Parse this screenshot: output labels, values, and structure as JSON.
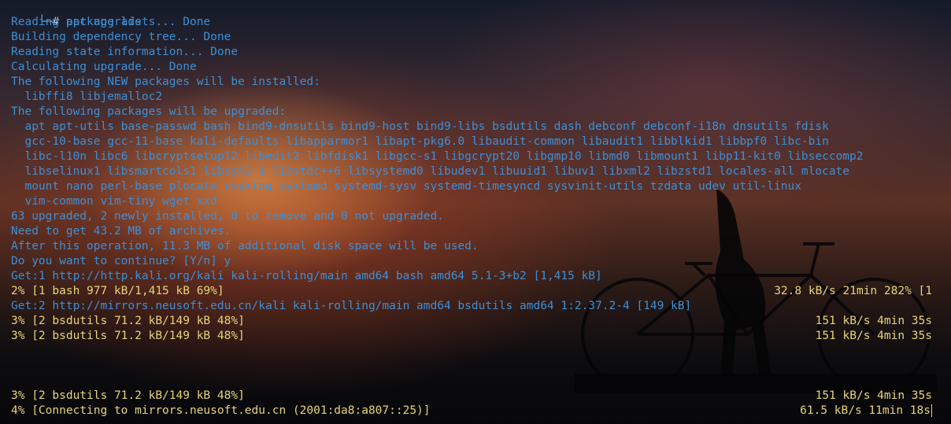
{
  "terminal": {
    "prompt": {
      "corner": "└─",
      "hash": "#",
      "command": "apt upgrade"
    },
    "lines": [
      "Reading package lists... Done",
      "Building dependency tree... Done",
      "Reading state information... Done",
      "Calculating upgrade... Done",
      "The following NEW packages will be installed:",
      "  libffi8 libjemalloc2",
      "The following packages will be upgraded:",
      "  apt apt-utils base-passwd bash bind9-dnsutils bind9-host bind9-libs bsdutils dash debconf debconf-i18n dnsutils fdisk",
      "  gcc-10-base gcc-11-base kali-defaults libapparmor1 libapt-pkg6.0 libaudit-common libaudit1 libblkid1 libbpf0 libc-bin",
      "  libc-l10n libc6 libcryptsetup12 libedit2 libfdisk1 libgcc-s1 libgcrypt20 libgmp10 libmd0 libmount1 libp11-kit0 libseccomp2",
      "  libselinux1 libsmartcols1 libssh2-1 libstdc++6 libsystemd0 libudev1 libuuid1 libuv1 libxml2 libzstd1 locales-all mlocate",
      "  mount nano perl-base plocate rsyslog systemd systemd-sysv systemd-timesyncd sysvinit-utils tzdata udev util-linux",
      "  vim-common vim-tiny wget xxd",
      "63 upgraded, 2 newly installed, 0 to remove and 0 not upgraded.",
      "Need to get 43.2 MB of archives.",
      "After this operation, 11.3 MB of additional disk space will be used.",
      "Do you want to continue? [Y/n] y",
      "Get:1 http://http.kali.org/kali kali-rolling/main amd64 bash amd64 5.1-3+b2 [1,415 kB]"
    ],
    "progress_1": {
      "left": "2% [1 bash 977 kB/1,415 kB 69%]",
      "right": "32.8 kB/s 21min 282% [1"
    },
    "get_2": "Get:2 http://mirrors.neusoft.edu.cn/kali kali-rolling/main amd64 bsdutils amd64 1:2.37.2-4 [149 kB]",
    "progress_2": {
      "left": "3% [2 bsdutils 71.2 kB/149 kB 48%]",
      "right": "151 kB/s 4min 35s"
    },
    "progress_3": {
      "left": "3% [2 bsdutils 71.2 kB/149 kB 48%]",
      "right": "151 kB/s 4min 35s"
    },
    "progress_4": {
      "left": "3% [2 bsdutils 71.2 kB/149 kB 48%]",
      "right": "151 kB/s 4min 35s"
    },
    "progress_5": {
      "left": "4% [Connecting to mirrors.neusoft.edu.cn (2001:da8:a807::25)]",
      "right": "61.5 kB/s 11min 18s"
    }
  }
}
